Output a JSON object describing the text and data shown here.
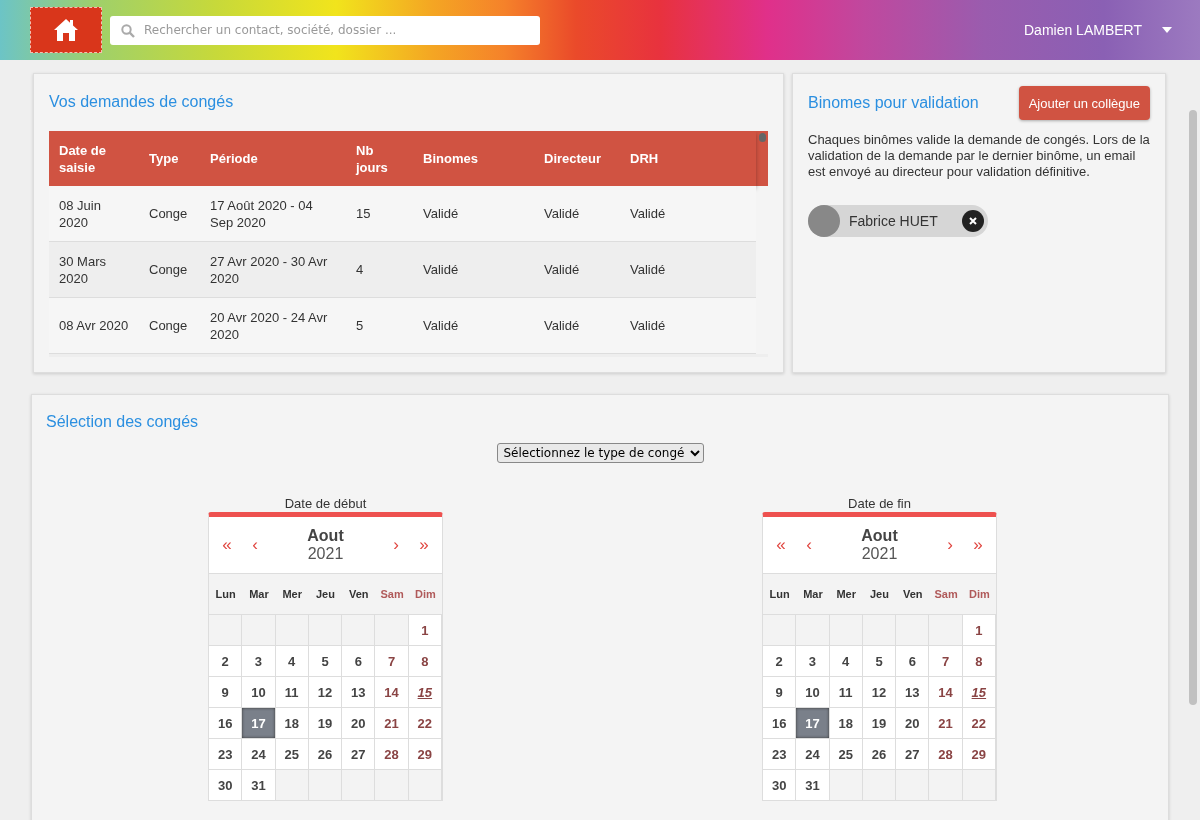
{
  "header": {
    "search": {
      "placeholder": "Rechercher un contact, société, dossier ..."
    },
    "user": "Damien LAMBERT"
  },
  "requests": {
    "title": "Vos demandes de congés",
    "columns": [
      "Date de saisie",
      "Type",
      "Période",
      "Nb jours",
      "Binomes",
      "Directeur",
      "DRH"
    ],
    "rows": [
      [
        "08 Juin 2020",
        "Conge",
        "17 Août 2020 - 04 Sep 2020",
        "15",
        "Validé",
        "Validé",
        "Validé"
      ],
      [
        "30 Mars 2020",
        "Conge",
        "27 Avr 2020 - 30 Avr 2020",
        "4",
        "Validé",
        "Validé",
        "Validé"
      ],
      [
        "08 Avr 2020",
        "Conge",
        "20 Avr 2020 - 24 Avr 2020",
        "5",
        "Validé",
        "Validé",
        "Validé"
      ]
    ]
  },
  "binomes": {
    "title": "Binomes pour validation",
    "add_button": "Ajouter un collègue",
    "description": "Chaques binômes valide la demande de congés. Lors de la validation de la demande par le dernier binôme, un email est envoyé au directeur pour validation définitive.",
    "members": [
      {
        "name": "Fabrice HUET"
      }
    ]
  },
  "selection": {
    "title": "Sélection des congés",
    "type_select": "Sélectionnez le type de congé",
    "calendars": [
      {
        "label": "Date de début",
        "prev_year": "«",
        "prev_month": "‹",
        "month": "Aout",
        "year": "2021",
        "next_month": "›",
        "next_year": "»",
        "weekdays": [
          {
            "name": "Lun",
            "weekend": false
          },
          {
            "name": "Mar",
            "weekend": false
          },
          {
            "name": "Mer",
            "weekend": false
          },
          {
            "name": "Jeu",
            "weekend": false
          },
          {
            "name": "Ven",
            "weekend": false
          },
          {
            "name": "Sam",
            "weekend": true
          },
          {
            "name": "Dim",
            "weekend": true
          }
        ],
        "weeks": [
          [
            {
              "day": "1",
              "selected": false,
              "today": false
            }
          ],
          [
            {
              "day": "2",
              "selected": false,
              "today": false
            },
            {
              "day": "3",
              "selected": false,
              "today": false
            },
            {
              "day": "4",
              "selected": false,
              "today": false
            },
            {
              "day": "5",
              "selected": false,
              "today": false
            },
            {
              "day": "6",
              "selected": false,
              "today": false
            },
            {
              "day": "7",
              "selected": false,
              "today": false
            },
            {
              "day": "8",
              "selected": false,
              "today": false
            }
          ],
          [
            {
              "day": "9",
              "selected": false,
              "today": false
            },
            {
              "day": "10",
              "selected": false,
              "today": false
            },
            {
              "day": "11",
              "selected": false,
              "today": false
            },
            {
              "day": "12",
              "selected": false,
              "today": false
            },
            {
              "day": "13",
              "selected": false,
              "today": false
            },
            {
              "day": "14",
              "selected": false,
              "today": false
            },
            {
              "day": "15",
              "selected": false,
              "today": true
            }
          ],
          [
            {
              "day": "16",
              "selected": false,
              "today": false
            },
            {
              "day": "17",
              "selected": true,
              "today": false
            },
            {
              "day": "18",
              "selected": false,
              "today": false
            },
            {
              "day": "19",
              "selected": false,
              "today": false
            },
            {
              "day": "20",
              "selected": false,
              "today": false
            },
            {
              "day": "21",
              "selected": false,
              "today": false
            },
            {
              "day": "22",
              "selected": false,
              "today": false
            }
          ],
          [
            {
              "day": "23",
              "selected": false,
              "today": false
            },
            {
              "day": "24",
              "selected": false,
              "today": false
            },
            {
              "day": "25",
              "selected": false,
              "today": false
            },
            {
              "day": "26",
              "selected": false,
              "today": false
            },
            {
              "day": "27",
              "selected": false,
              "today": false
            },
            {
              "day": "28",
              "selected": false,
              "today": false
            },
            {
              "day": "29",
              "selected": false,
              "today": false
            }
          ],
          [
            {
              "day": "30",
              "selected": false,
              "today": false
            },
            {
              "day": "31",
              "selected": false,
              "today": false
            }
          ]
        ]
      },
      {
        "label": "Date de fin",
        "prev_year": "«",
        "prev_month": "‹",
        "month": "Aout",
        "year": "2021",
        "next_month": "›",
        "next_year": "»",
        "weekdays": [
          {
            "name": "Lun",
            "weekend": false
          },
          {
            "name": "Mar",
            "weekend": false
          },
          {
            "name": "Mer",
            "weekend": false
          },
          {
            "name": "Jeu",
            "weekend": false
          },
          {
            "name": "Ven",
            "weekend": false
          },
          {
            "name": "Sam",
            "weekend": true
          },
          {
            "name": "Dim",
            "weekend": true
          }
        ],
        "weeks": [
          [
            {
              "day": "1",
              "selected": false,
              "today": false
            }
          ],
          [
            {
              "day": "2",
              "selected": false,
              "today": false
            },
            {
              "day": "3",
              "selected": false,
              "today": false
            },
            {
              "day": "4",
              "selected": false,
              "today": false
            },
            {
              "day": "5",
              "selected": false,
              "today": false
            },
            {
              "day": "6",
              "selected": false,
              "today": false
            },
            {
              "day": "7",
              "selected": false,
              "today": false
            },
            {
              "day": "8",
              "selected": false,
              "today": false
            }
          ],
          [
            {
              "day": "9",
              "selected": false,
              "today": false
            },
            {
              "day": "10",
              "selected": false,
              "today": false
            },
            {
              "day": "11",
              "selected": false,
              "today": false
            },
            {
              "day": "12",
              "selected": false,
              "today": false
            },
            {
              "day": "13",
              "selected": false,
              "today": false
            },
            {
              "day": "14",
              "selected": false,
              "today": false
            },
            {
              "day": "15",
              "selected": false,
              "today": true
            }
          ],
          [
            {
              "day": "16",
              "selected": false,
              "today": false
            },
            {
              "day": "17",
              "selected": true,
              "today": false
            },
            {
              "day": "18",
              "selected": false,
              "today": false
            },
            {
              "day": "19",
              "selected": false,
              "today": false
            },
            {
              "day": "20",
              "selected": false,
              "today": false
            },
            {
              "day": "21",
              "selected": false,
              "today": false
            },
            {
              "day": "22",
              "selected": false,
              "today": false
            }
          ],
          [
            {
              "day": "23",
              "selected": false,
              "today": false
            },
            {
              "day": "24",
              "selected": false,
              "today": false
            },
            {
              "day": "25",
              "selected": false,
              "today": false
            },
            {
              "day": "26",
              "selected": false,
              "today": false
            },
            {
              "day": "27",
              "selected": false,
              "today": false
            },
            {
              "day": "28",
              "selected": false,
              "today": false
            },
            {
              "day": "29",
              "selected": false,
              "today": false
            }
          ],
          [
            {
              "day": "30",
              "selected": false,
              "today": false
            },
            {
              "day": "31",
              "selected": false,
              "today": false
            }
          ]
        ]
      }
    ]
  }
}
